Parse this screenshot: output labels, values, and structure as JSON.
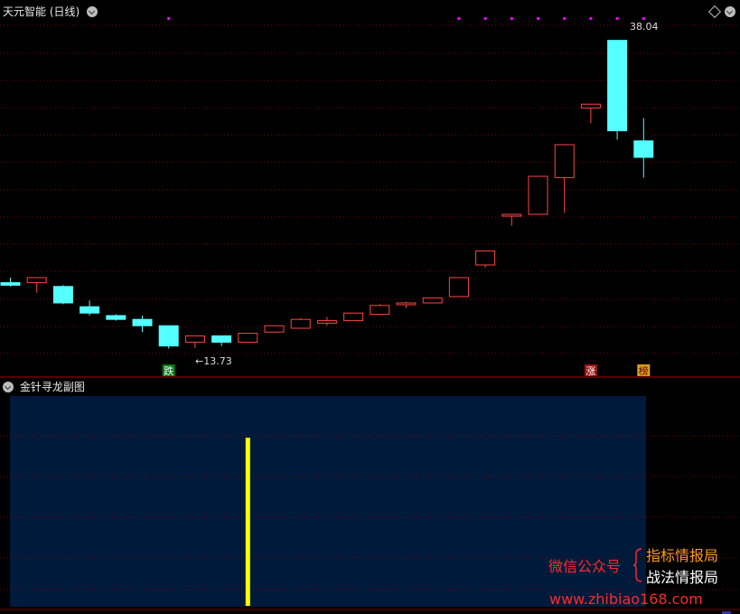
{
  "main_panel": {
    "title": "天元智能 (日线)"
  },
  "sub_panel": {
    "title": "金针寻龙副图"
  },
  "markers": {
    "fall": "跌",
    "rise": "涨",
    "rank": "榜"
  },
  "watermark": {
    "left": "微信公众号",
    "line1": "指标情报局",
    "line2": "战法情报局",
    "url": "www.zhibiao168.com"
  },
  "colors": {
    "up": "#ff4444",
    "down": "#54ffff",
    "grid": "#7a0000",
    "sub_bg": "#001a3b",
    "signal": "#ffff00",
    "dots": "#ff00ff"
  },
  "chart_data": [
    {
      "type": "candlestick",
      "title": "天元智能 (日线)",
      "ylim": [
        12.8,
        39.8
      ],
      "annotations": [
        {
          "text": "38.04",
          "candle": 23,
          "value": 38.04
        },
        {
          "text": "←13.73",
          "candle": 7,
          "value": 13.73
        }
      ],
      "candles": [
        {
          "o": 18.9,
          "h": 19.3,
          "l": 18.6,
          "c": 18.7
        },
        {
          "o": 18.9,
          "h": 19.2,
          "l": 18.1,
          "c": 19.3
        },
        {
          "o": 18.6,
          "h": 18.7,
          "l": 17.2,
          "c": 17.3
        },
        {
          "o": 17.0,
          "h": 17.5,
          "l": 16.3,
          "c": 16.5
        },
        {
          "o": 16.3,
          "h": 16.4,
          "l": 15.9,
          "c": 16.0
        },
        {
          "o": 16.0,
          "h": 16.3,
          "l": 15.0,
          "c": 15.5
        },
        {
          "o": 15.5,
          "h": 15.5,
          "l": 13.7,
          "c": 13.9
        },
        {
          "o": 14.2,
          "h": 14.5,
          "l": 13.73,
          "c": 14.7
        },
        {
          "o": 14.7,
          "h": 14.7,
          "l": 13.9,
          "c": 14.2
        },
        {
          "o": 14.2,
          "h": 14.9,
          "l": 14.2,
          "c": 14.9
        },
        {
          "o": 15.0,
          "h": 15.5,
          "l": 15.0,
          "c": 15.5
        },
        {
          "o": 15.3,
          "h": 16.1,
          "l": 15.3,
          "c": 16.0
        },
        {
          "o": 15.7,
          "h": 16.2,
          "l": 15.5,
          "c": 15.9
        },
        {
          "o": 15.9,
          "h": 16.5,
          "l": 15.9,
          "c": 16.5
        },
        {
          "o": 16.4,
          "h": 17.2,
          "l": 16.4,
          "c": 17.1
        },
        {
          "o": 17.2,
          "h": 17.4,
          "l": 16.9,
          "c": 17.3
        },
        {
          "o": 17.3,
          "h": 17.7,
          "l": 17.3,
          "c": 17.7
        },
        {
          "o": 17.8,
          "h": 19.3,
          "l": 17.8,
          "c": 19.3
        },
        {
          "o": 20.3,
          "h": 21.4,
          "l": 20.1,
          "c": 21.4
        },
        {
          "o": 24.3,
          "h": 24.3,
          "l": 23.4,
          "c": 24.3
        },
        {
          "o": 24.3,
          "h": 27.3,
          "l": 24.3,
          "c": 27.3
        },
        {
          "o": 27.2,
          "h": 29.8,
          "l": 24.4,
          "c": 29.8
        },
        {
          "o": 32.7,
          "h": 33.0,
          "l": 31.5,
          "c": 33.0
        },
        {
          "o": 38.04,
          "h": 38.04,
          "l": 30.2,
          "c": 30.9
        },
        {
          "o": 30.1,
          "h": 31.9,
          "l": 27.2,
          "c": 28.8
        }
      ],
      "top_dot_candles": [
        6,
        17,
        18,
        19,
        20,
        21,
        22,
        23,
        24
      ],
      "bottom_labels": [
        {
          "candle": 6,
          "key": "fall"
        },
        {
          "candle": 22,
          "key": "rise"
        },
        {
          "candle": 24,
          "key": "rank"
        }
      ]
    },
    {
      "type": "bar",
      "title": "金针寻龙副图",
      "signals": [
        {
          "candle": 9,
          "value": 1
        }
      ]
    }
  ]
}
